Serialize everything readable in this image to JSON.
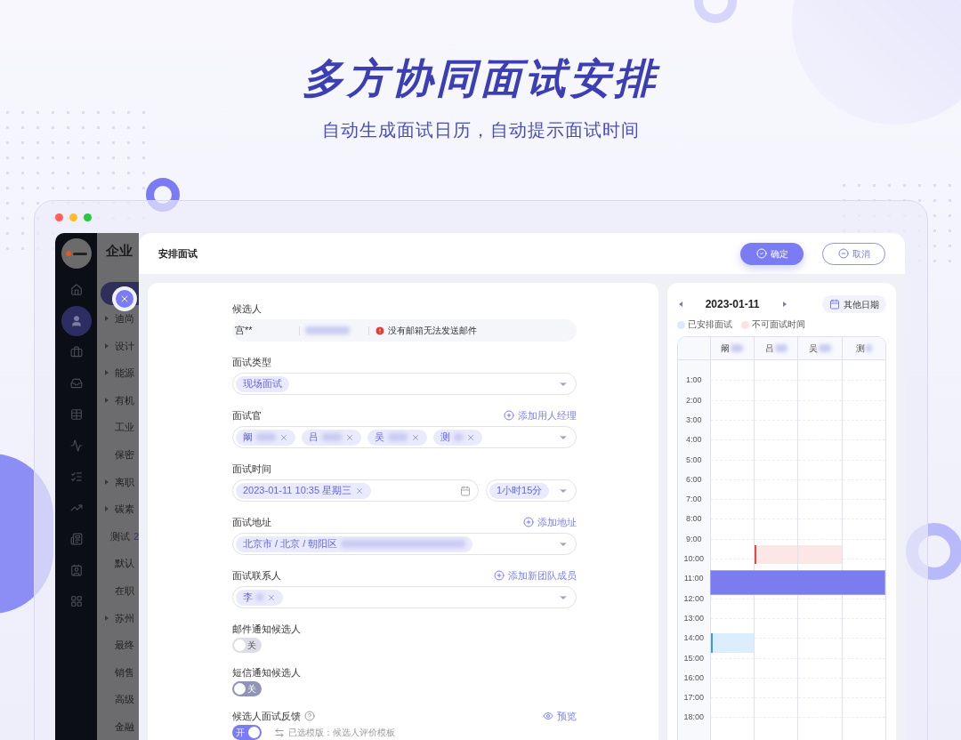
{
  "hero": {
    "title": "多方协同面试安排",
    "subtitle": "自动生成面试日历，自动提示面试时间"
  },
  "nav_icons": [
    {
      "selected": false
    },
    {
      "selected": true
    },
    {
      "selected": false
    },
    {
      "selected": false
    },
    {
      "selected": false
    },
    {
      "selected": false
    },
    {
      "selected": false
    },
    {
      "selected": false
    },
    {
      "selected": false
    },
    {
      "selected": false
    },
    {
      "selected": false
    }
  ],
  "background_list": {
    "heading": "企业",
    "items": [
      {
        "label": "迪尚",
        "expandable": true
      },
      {
        "label": "设计",
        "expandable": true
      },
      {
        "label": "能源",
        "expandable": true
      },
      {
        "label": "有机",
        "expandable": true
      },
      {
        "label": "工业",
        "expandable": false
      },
      {
        "label": "保密",
        "expandable": false
      },
      {
        "label": "离职",
        "expandable": true
      },
      {
        "label": "碳素",
        "expandable": true
      },
      {
        "label": "测试",
        "count": "2",
        "expandable": false
      },
      {
        "label": "默认",
        "expandable": false
      },
      {
        "label": "在职",
        "expandable": false
      },
      {
        "label": "苏州",
        "expandable": true
      },
      {
        "label": "最终",
        "expandable": false
      },
      {
        "label": "销售",
        "expandable": false
      },
      {
        "label": "高级",
        "expandable": false
      },
      {
        "label": "金融",
        "expandable": false
      }
    ]
  },
  "dialog": {
    "title": "安排面试",
    "confirm": "确定",
    "cancel": "取消"
  },
  "form": {
    "candidate": {
      "label": "候选人",
      "name": "宫**",
      "warning": "没有邮箱无法发送邮件"
    },
    "type": {
      "label": "面试类型",
      "value": "现场面试"
    },
    "interviewers": {
      "label": "面试官",
      "action": "添加用人经理",
      "chips": [
        {
          "text": "阚"
        },
        {
          "text": "吕"
        },
        {
          "text": "吴"
        },
        {
          "text": "测"
        }
      ]
    },
    "time": {
      "label": "面试时间",
      "value": "2023-01-11 10:35 星期三",
      "duration": "1小时15分"
    },
    "address": {
      "label": "面试地址",
      "action": "添加地址",
      "value": "北京市 / 北京 / 朝阳区"
    },
    "contact": {
      "label": "面试联系人",
      "action": "添加新团队成员",
      "chips": [
        {
          "text": "李"
        }
      ]
    },
    "toggles": [
      {
        "label": "邮件通知候选人",
        "on": false,
        "disabled": true,
        "text": "关"
      },
      {
        "label": "短信通知候选人",
        "on": false,
        "disabled": false,
        "text": "关"
      },
      {
        "label": "候选人面试反馈",
        "on": true,
        "disabled": false,
        "text": "开",
        "help": true,
        "action": "预览",
        "template": "已选模版：候选人评价模板"
      }
    ]
  },
  "calendar": {
    "date": "2023-01-11",
    "other_dates": "其他日期",
    "legend": [
      {
        "label": "已安排面试",
        "color": "#dbeafe"
      },
      {
        "label": "不可面试时间",
        "color": "#fde2e2"
      }
    ],
    "columns": [
      {
        "name": "阚",
        "events": [
          {
            "kind": "booked",
            "accent": true
          }
        ]
      },
      {
        "name": "吕",
        "events": [
          {
            "kind": "unavailable",
            "accent": true
          }
        ]
      },
      {
        "name": "吴",
        "events": [
          {
            "kind": "unavailable",
            "accent": false
          }
        ]
      },
      {
        "name": "测"
      }
    ],
    "hours": [
      "1:00",
      "2:00",
      "3:00",
      "4:00",
      "5:00",
      "6:00",
      "7:00",
      "8:00",
      "9:00",
      "10:00",
      "11:00",
      "12:00",
      "13:00",
      "14:00",
      "15:00",
      "16:00",
      "17:00",
      "18:00"
    ]
  }
}
